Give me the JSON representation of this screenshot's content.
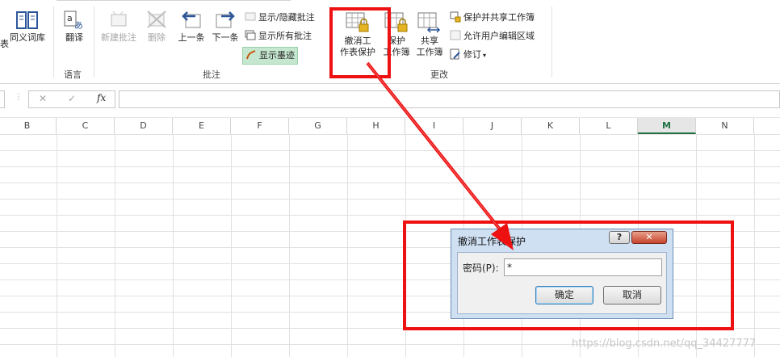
{
  "ribbon": {
    "partial_left_label": "表",
    "thesaurus": "同义词库",
    "translate": "翻译",
    "new_comment": "新建批注",
    "delete": "删除",
    "previous": "上一条",
    "next": "下一条",
    "show_hide_comment": "显示/隐藏批注",
    "show_all_comments": "显示所有批注",
    "show_ink": "显示墨迹",
    "unprotect_sheet_line1": "撤消工",
    "unprotect_sheet_line2": "作表保护",
    "protect_workbook_line1": "保护",
    "protect_workbook_line2": "工作簿",
    "share_workbook_line1": "共享",
    "share_workbook_line2": "工作簿",
    "protect_and_share": "保护并共享工作簿",
    "allow_edit_ranges": "允许用户编辑区域",
    "track_changes": "修订",
    "groups": {
      "language": "语言",
      "comments": "批注",
      "changes": "更改"
    }
  },
  "formula_bar": {
    "cancel": "✕",
    "enter": "✓",
    "fx": "fx",
    "value": ""
  },
  "columns": [
    "B",
    "C",
    "D",
    "E",
    "F",
    "G",
    "H",
    "I",
    "J",
    "K",
    "L",
    "M",
    "N"
  ],
  "selected_column": "M",
  "dialog": {
    "title": "撤消工作表保护",
    "help": "?",
    "close": "✕",
    "password_label": "密码(P):",
    "password_value": "*",
    "ok": "确定",
    "cancel": "取消"
  },
  "watermark": "https://blog.csdn.net/qq_34427777",
  "colors": {
    "highlight_red": "#ee1111",
    "excel_green": "#217346",
    "dialog_blue": "#cfe0f3"
  }
}
